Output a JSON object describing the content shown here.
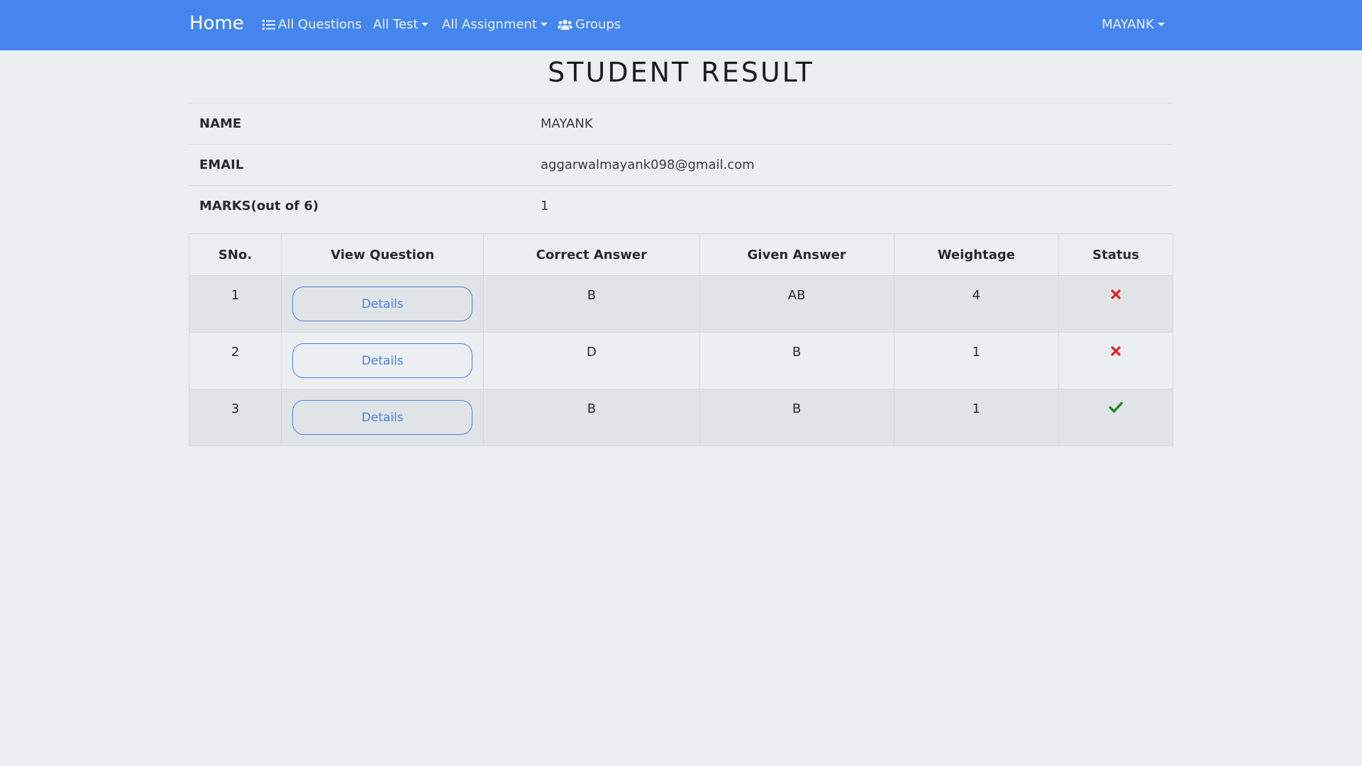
{
  "nav": {
    "brand": "Home",
    "all_questions": "All Questions",
    "all_test": "All Test",
    "all_assignment": "All Assignment",
    "groups": "Groups",
    "user": "MAYANK",
    "icons": {
      "all_questions": "list-icon",
      "groups": "users-icon"
    },
    "bg_color": "#4585ee"
  },
  "page": {
    "title": "STUDENT RESULT"
  },
  "info": {
    "name_label": "NAME",
    "name_value": "MAYANK",
    "email_label": "EMAIL",
    "email_value": "aggarwalmayank098@gmail.com",
    "marks_label": "MARKS(out of 6)",
    "marks_value": "1"
  },
  "table": {
    "headers": [
      "SNo.",
      "View Question",
      "Correct Answer",
      "Given Answer",
      "Weightage",
      "Status"
    ],
    "details_label": "Details",
    "rows": [
      {
        "sno": "1",
        "correct": "B",
        "given": "AB",
        "weightage": "4",
        "status": "wrong"
      },
      {
        "sno": "2",
        "correct": "D",
        "given": "B",
        "weightage": "1",
        "status": "wrong"
      },
      {
        "sno": "3",
        "correct": "B",
        "given": "B",
        "weightage": "1",
        "status": "correct"
      }
    ],
    "colors": {
      "wrong": "#e02020",
      "correct": "#1a8a1a",
      "button": "#4a80e3"
    }
  }
}
